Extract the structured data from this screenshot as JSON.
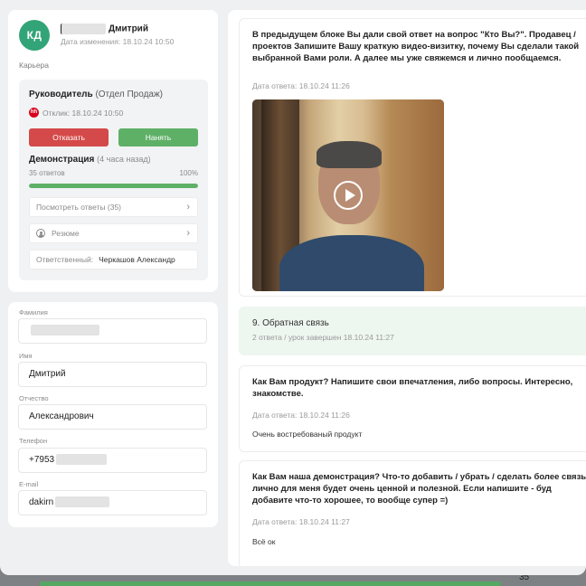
{
  "background": {
    "bottom_count": "35",
    "bottom_label": "□ □□□□□□□□ □□ □□□□□",
    "bottom_num": "□□□",
    "progress_color": "#55a862"
  },
  "candidate": {
    "initials": "КД",
    "first_name": "Дмитрий",
    "changed": "Дата изменения: 18.10.24 10:50",
    "section": "Карьера",
    "avatar_color": "#33a477"
  },
  "position": {
    "role": "Руководитель",
    "department": "(Отдел Продаж)",
    "source_icon": "hh-icon",
    "response": "Отклик: 18.10.24 10:50",
    "reject_label": "Отказать",
    "hire_label": "Нанять",
    "demo_title": "Демонстрация",
    "demo_ago": "(4 часа назад)",
    "answers_count": "35 ответов",
    "percent_label": "100%",
    "progress": 1.0,
    "view_answers": "Посмотреть ответы (35)",
    "resume": "Резюме",
    "responsible_label": "Ответственный:",
    "responsible_name": "Черкашов Александр"
  },
  "form": {
    "surname_label": "Фамилия",
    "surname_value": "",
    "name_label": "Имя",
    "name_value": "Дмитрий",
    "patronymic_label": "Отчество",
    "patronymic_value": "Александрович",
    "phone_label": "Телефон",
    "phone_value": "+7953",
    "email_label": "E-mail",
    "email_value": "dakirn"
  },
  "feed": {
    "q1_text": "В предыдущем блоке Вы дали свой ответ на вопрос \"Кто Вы?\". Продавец / проектов Запишите Вашу краткую видео-визитку, почему Вы сделали такой выбранной Вами роли. А далее мы уже свяжемся и лично пообщаемся.",
    "q1_date": "Дата ответа: 18.10.24 11:26",
    "feedback_title": "9. Обратная связь",
    "feedback_sub": "2 ответа / урок завершен 18.10.24 11:27",
    "q2_text": "Как Вам продукт? Напишите свои впечатления, либо вопросы. Интересно, знакомстве.",
    "q2_date": "Дата ответа: 18.10.24 11:26",
    "q2_answer": "Очень востребованый продукт",
    "q3_text": "Как Вам наша демонстрация?  Что-то добавить / убрать / сделать более связь лично для меня будет очень ценной и полезной. Если напишите - буд добавите что-то хорошее, то вообще супер =)",
    "q3_date": "Дата ответа: 18.10.24 11:27",
    "q3_answer": "Всё ок"
  }
}
